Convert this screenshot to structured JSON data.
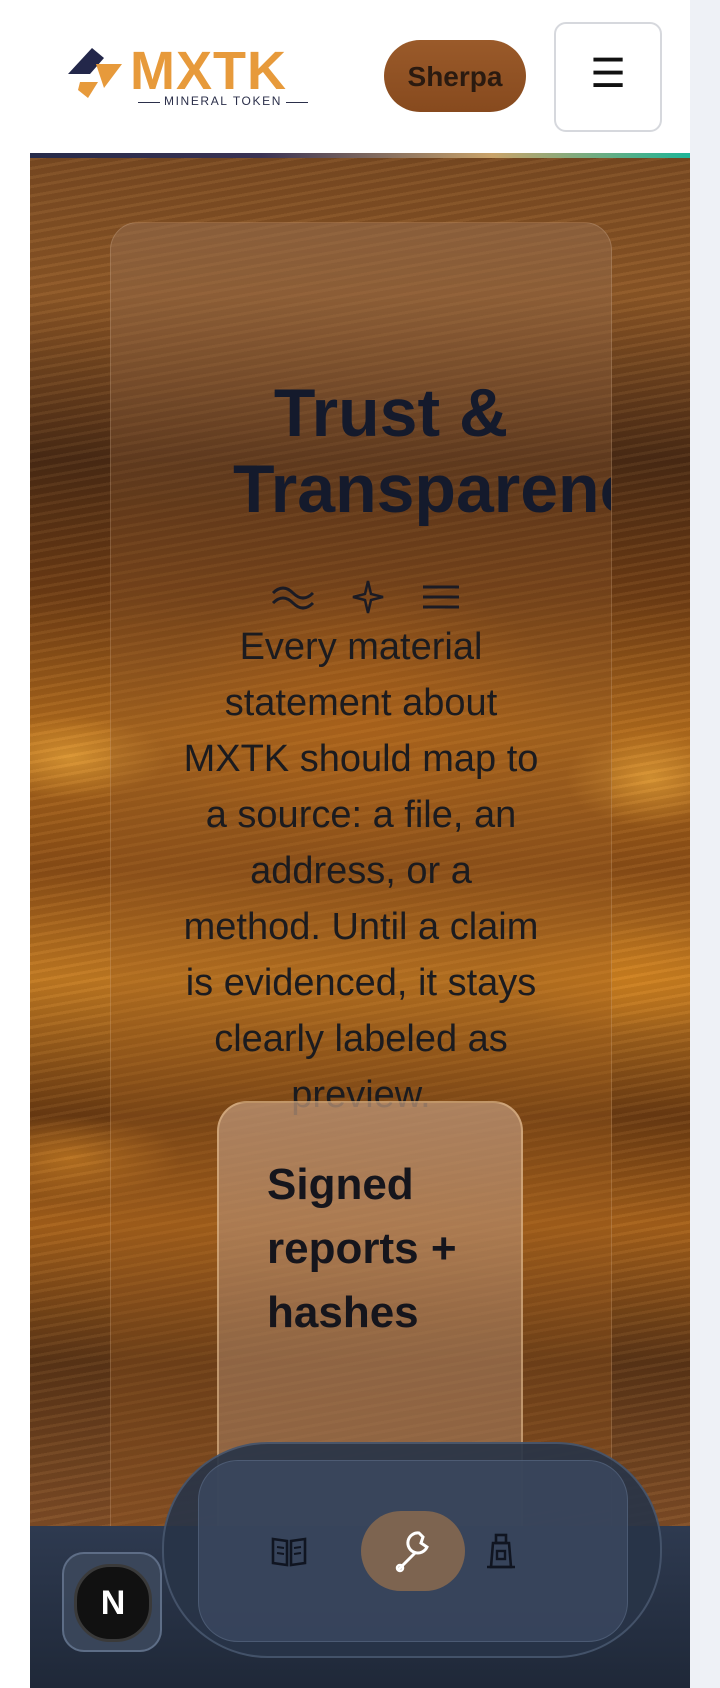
{
  "header": {
    "logo_text": "MXTK",
    "logo_subtitle": "MINERAL TOKEN",
    "sherpa_label": "Sherpa",
    "menu_icon": "☰"
  },
  "hero": {
    "title_line1": "Trust &",
    "title_line2": "Transparenc",
    "icons": [
      "waves-icon",
      "sparkle-icon",
      "lines-icon"
    ],
    "body": "Every material statement about MXTK should map to a source: a file, an address, or a method. Until a claim is evidenced, it stays clearly labeled as preview.",
    "inner_card_title": "Signed reports + hashes"
  },
  "dock": {
    "items": [
      {
        "name": "book-icon",
        "active": false
      },
      {
        "name": "wrench-icon",
        "active": true
      },
      {
        "name": "lighthouse-icon",
        "active": false
      }
    ]
  },
  "badge": {
    "letter": "N"
  },
  "colors": {
    "accent": "#e79a3b",
    "sherpa": "#8f5023",
    "dark_navy": "#141a2c",
    "dock": "#283448"
  }
}
